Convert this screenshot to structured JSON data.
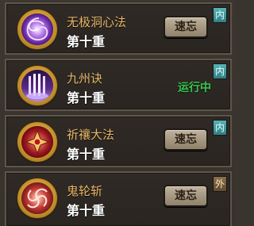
{
  "skills": [
    {
      "name": "无极洞心法",
      "level": "第十重",
      "action": "速忘",
      "tag": "内",
      "tag_type": "inner",
      "icon": "purple-vortex-icon"
    },
    {
      "name": "九州诀",
      "level": "第十重",
      "status": "运行中",
      "tag": "内",
      "tag_type": "inner",
      "icon": "purple-pillars-icon"
    },
    {
      "name": "祈禳大法",
      "level": "第十重",
      "action": "速忘",
      "tag": "内",
      "tag_type": "inner",
      "icon": "red-emblem-icon"
    },
    {
      "name": "鬼轮斩",
      "level": "第十重",
      "action": "速忘",
      "tag": "外",
      "tag_type": "outer",
      "icon": "red-swirl-icon"
    }
  ],
  "colors": {
    "name": "#e8b86a",
    "status": "#39c64f",
    "inner_tag": "#2f7f84",
    "outer_tag": "#5f4a31"
  }
}
